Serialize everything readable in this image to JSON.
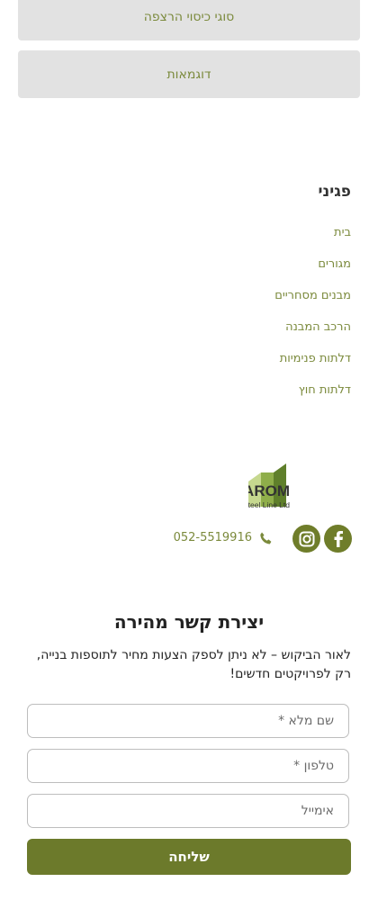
{
  "buttons": {
    "floor_coverings": "סוגי כיסוי הרצפה",
    "examples": "דוגמאות"
  },
  "pages": {
    "title": "פגיני",
    "links": [
      "בית",
      "מגורים",
      "מבנים מסחריים",
      "הרכב המבנה",
      "דלתות פנימיות",
      "דלתות חוץ"
    ]
  },
  "logo": {
    "name": "MAROM",
    "subtitle": "Steel Line Ltd."
  },
  "contact": {
    "phone": "052-5519916",
    "phone_icon": "phone-icon",
    "social": [
      "facebook-icon",
      "instagram-icon"
    ]
  },
  "form": {
    "title": "יצירת קשר מהירה",
    "note": "לאור הביקוש – לא ניתן לספק הצעות מחיר לתוספות בנייה, רק לפרויקטים חדשים!",
    "name_placeholder": "שם מלא *",
    "phone_placeholder": "טלפון *",
    "email_placeholder": "אימייל",
    "submit_label": "שליחה"
  },
  "colors": {
    "accent": "#6c7a2b",
    "link": "#7b8a3c",
    "button_bg": "#e2e2e2"
  }
}
